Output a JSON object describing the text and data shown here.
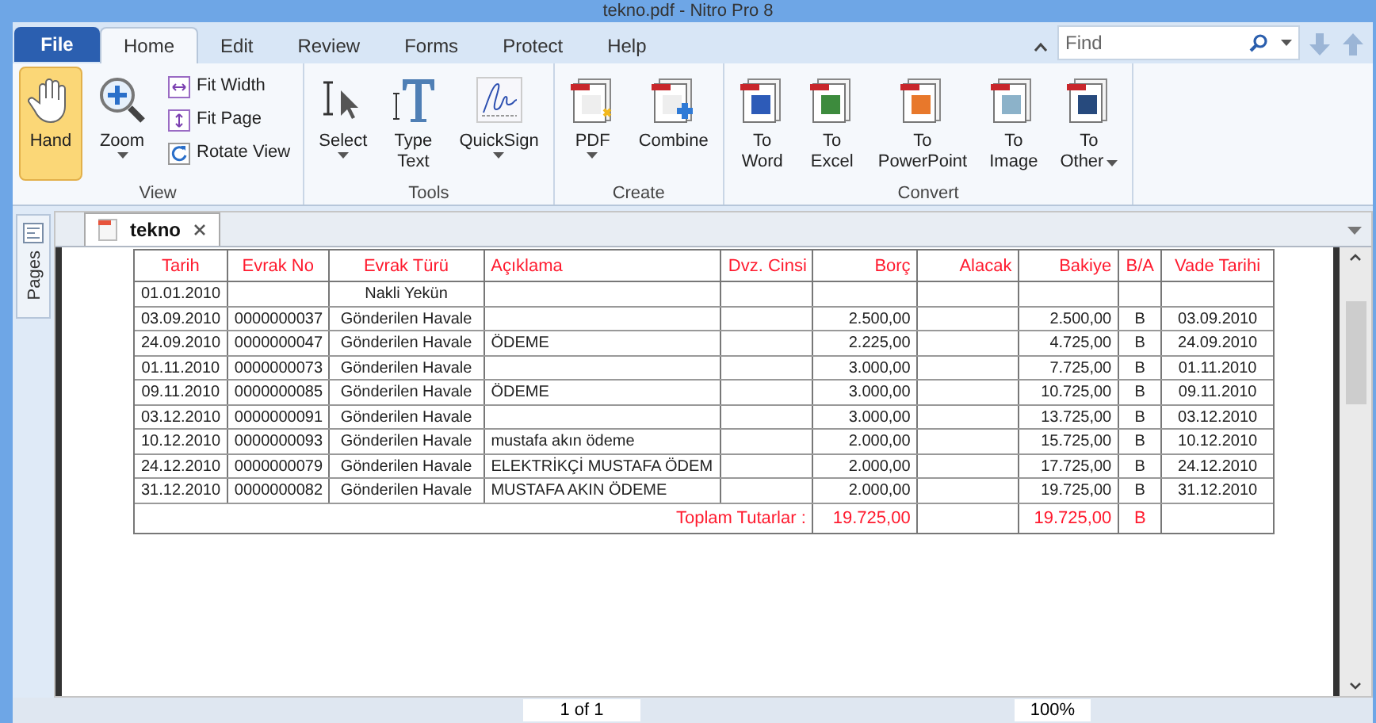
{
  "window": {
    "title": "tekno.pdf - Nitro Pro 8"
  },
  "file_button": "File",
  "menu_tabs": [
    {
      "label": "Home",
      "selected": true
    },
    {
      "label": "Edit",
      "selected": false
    },
    {
      "label": "Review",
      "selected": false
    },
    {
      "label": "Forms",
      "selected": false
    },
    {
      "label": "Protect",
      "selected": false
    },
    {
      "label": "Help",
      "selected": false
    }
  ],
  "search": {
    "placeholder": "Find"
  },
  "ribbon": {
    "groups": [
      {
        "label": "View",
        "buttons": [
          {
            "kind": "large",
            "lines": [
              "Hand"
            ],
            "selected": true,
            "dropdown": false
          },
          {
            "kind": "large",
            "lines": [
              "Zoom"
            ],
            "selected": false,
            "dropdown": true
          },
          {
            "kind": "small",
            "lines": [
              "Fit Width"
            ],
            "selected": false
          },
          {
            "kind": "small",
            "lines": [
              "Fit Page"
            ],
            "selected": false
          },
          {
            "kind": "small",
            "lines": [
              "Rotate View"
            ],
            "selected": false
          }
        ]
      },
      {
        "label": "Tools",
        "buttons": [
          {
            "kind": "large",
            "lines": [
              "Select"
            ],
            "selected": false,
            "dropdown": true
          },
          {
            "kind": "large",
            "lines": [
              "Type",
              "Text"
            ],
            "selected": false,
            "dropdown": false
          },
          {
            "kind": "large",
            "lines": [
              "QuickSign"
            ],
            "selected": false,
            "dropdown": true
          }
        ]
      },
      {
        "label": "Create",
        "buttons": [
          {
            "kind": "large",
            "lines": [
              "PDF"
            ],
            "selected": false,
            "dropdown": true
          },
          {
            "kind": "large",
            "lines": [
              "Combine"
            ],
            "selected": false,
            "dropdown": false
          }
        ]
      },
      {
        "label": "Convert",
        "buttons": [
          {
            "kind": "large",
            "lines": [
              "To",
              "Word"
            ],
            "selected": false,
            "dropdown": false
          },
          {
            "kind": "large",
            "lines": [
              "To",
              "Excel"
            ],
            "selected": false,
            "dropdown": false
          },
          {
            "kind": "large",
            "lines": [
              "To",
              "PowerPoint"
            ],
            "selected": false,
            "dropdown": false
          },
          {
            "kind": "large",
            "lines": [
              "To",
              "Image"
            ],
            "selected": false,
            "dropdown": false
          },
          {
            "kind": "large",
            "lines": [
              "To",
              "Other"
            ],
            "selected": false,
            "dropdown": true
          }
        ]
      }
    ]
  },
  "sidebar": {
    "tab": "Pages"
  },
  "document_tab": {
    "label": "tekno"
  },
  "table": {
    "columns": [
      "Tarih",
      "Evrak No",
      "Evrak Türü",
      "Açıklama",
      "Dvz. Cinsi",
      "Borç",
      "Alacak",
      "Bakiye",
      "B/A",
      "Vade Tarihi"
    ],
    "rows": [
      [
        "01.01.2010",
        "",
        "Nakli Yekün",
        "",
        "",
        "",
        "",
        "",
        "",
        ""
      ],
      [
        "03.09.2010",
        "0000000037",
        "Gönderilen Havale",
        "",
        "",
        "2.500,00",
        "",
        "2.500,00",
        "B",
        "03.09.2010"
      ],
      [
        "24.09.2010",
        "0000000047",
        "Gönderilen Havale",
        "ÖDEME",
        "",
        "2.225,00",
        "",
        "4.725,00",
        "B",
        "24.09.2010"
      ],
      [
        "01.11.2010",
        "0000000073",
        "Gönderilen Havale",
        "",
        "",
        "3.000,00",
        "",
        "7.725,00",
        "B",
        "01.11.2010"
      ],
      [
        "09.11.2010",
        "0000000085",
        "Gönderilen Havale",
        "ÖDEME",
        "",
        "3.000,00",
        "",
        "10.725,00",
        "B",
        "09.11.2010"
      ],
      [
        "03.12.2010",
        "0000000091",
        "Gönderilen Havale",
        "",
        "",
        "3.000,00",
        "",
        "13.725,00",
        "B",
        "03.12.2010"
      ],
      [
        "10.12.2010",
        "0000000093",
        "Gönderilen Havale",
        "mustafa akın ödeme",
        "",
        "2.000,00",
        "",
        "15.725,00",
        "B",
        "10.12.2010"
      ],
      [
        "24.12.2010",
        "0000000079",
        "Gönderilen Havale",
        "ELEKTRİKÇİ MUSTAFA ÖDEM",
        "",
        "2.000,00",
        "",
        "17.725,00",
        "B",
        "24.12.2010"
      ],
      [
        "31.12.2010",
        "0000000082",
        "Gönderilen Havale",
        "MUSTAFA AKIN ÖDEME",
        "",
        "2.000,00",
        "",
        "19.725,00",
        "B",
        "31.12.2010"
      ]
    ],
    "total": {
      "label": "Toplam Tutarlar :",
      "borc": "19.725,00",
      "bakiye": "19.725,00",
      "ba": "B"
    }
  },
  "status_bar": {
    "page": "1 of 1",
    "zoom": "100%"
  }
}
